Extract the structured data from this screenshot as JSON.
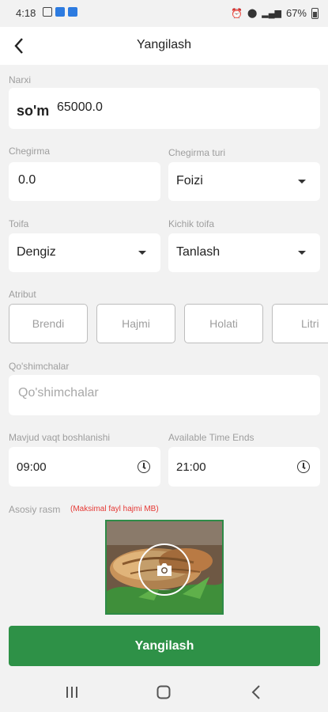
{
  "status_bar": {
    "time": "4:18",
    "battery": "67%"
  },
  "app_bar": {
    "title": "Yangilash"
  },
  "price": {
    "label": "Narxi",
    "currency": "so'm",
    "value": "65000.0"
  },
  "discount": {
    "label": "Chegirma",
    "value": "0.0"
  },
  "discount_type": {
    "label": "Chegirma turi",
    "value": "Foizi"
  },
  "category": {
    "label": "Toifa",
    "value": "Dengiz"
  },
  "subcategory": {
    "label": "Kichik toifa",
    "value": "Tanlash"
  },
  "attributes": {
    "label": "Atribut",
    "items": [
      "Brendi",
      "Hajmi",
      "Holati",
      "Litri"
    ]
  },
  "addons": {
    "label": "Qo'shimchalar",
    "placeholder": "Qo'shimchalar"
  },
  "time_start": {
    "label": "Mavjud vaqt boshlanishi",
    "value": "09:00"
  },
  "time_end": {
    "label": "Available Time Ends",
    "value": "21:00"
  },
  "main_image": {
    "label": "Asosiy rasm",
    "hint": "(Maksimal fayl hajmi MB)"
  },
  "submit": {
    "label": "Yangilash"
  },
  "colors": {
    "primary": "#2e9147",
    "hint": "#e53935",
    "background": "#f2f2f2"
  }
}
